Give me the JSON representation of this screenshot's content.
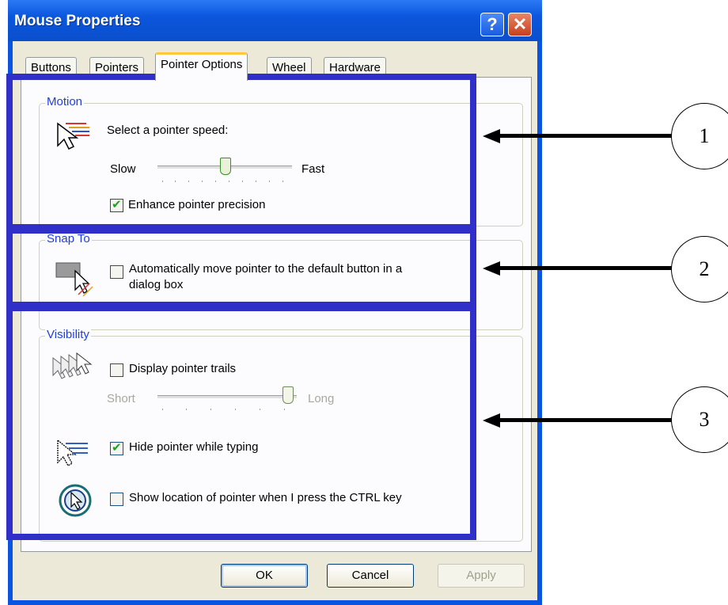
{
  "window": {
    "title": "Mouse Properties"
  },
  "titlebar_buttons": {
    "help": "?",
    "close": "✕"
  },
  "tabs": [
    {
      "label": "Buttons"
    },
    {
      "label": "Pointers"
    },
    {
      "label": "Pointer Options",
      "selected": true
    },
    {
      "label": "Wheel"
    },
    {
      "label": "Hardware"
    }
  ],
  "motion": {
    "group_label": "Motion",
    "speed_label": "Select a pointer speed:",
    "slow_label": "Slow",
    "fast_label": "Fast",
    "speed_level": 0.5,
    "enhance": {
      "label": "Enhance pointer precision",
      "checked": true
    }
  },
  "snap_to": {
    "group_label": "Snap To",
    "auto_move": {
      "label_line1": "Automatically move pointer to the default button in a",
      "label_line2": "dialog box",
      "checked": false
    }
  },
  "visibility": {
    "group_label": "Visibility",
    "trails": {
      "label": "Display pointer trails",
      "checked": false,
      "short_label": "Short",
      "long_label": "Long",
      "trail_level": 1.0
    },
    "hide_typing": {
      "label": "Hide pointer while typing",
      "checked": true
    },
    "show_location": {
      "label": "Show location of pointer when I press the CTRL key",
      "checked": false
    }
  },
  "buttons": {
    "ok": "OK",
    "cancel": "Cancel",
    "apply": "Apply"
  },
  "callouts": [
    "1",
    "2",
    "3"
  ],
  "colors": {
    "highlight": "#3030c8",
    "titlebar": "#0a54e0",
    "group_label": "#1f3fd8"
  }
}
